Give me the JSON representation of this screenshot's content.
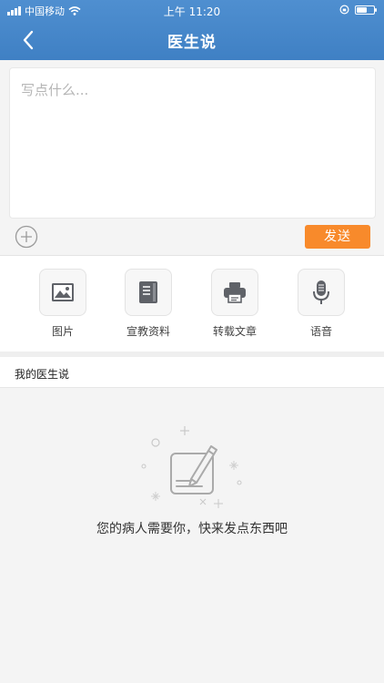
{
  "status_bar": {
    "carrier": "中国移动",
    "time": "上午 11:20"
  },
  "nav": {
    "title": "医生说",
    "back_icon": "chevron-left-icon"
  },
  "composer": {
    "placeholder": "写点什么...",
    "value": "",
    "send_label": "发送",
    "add_icon": "plus-circle-icon",
    "send_color": "#f88a2b"
  },
  "attachments": [
    {
      "label": "图片",
      "icon": "image-icon"
    },
    {
      "label": "宣教资料",
      "icon": "book-icon"
    },
    {
      "label": "转载文章",
      "icon": "printer-icon"
    },
    {
      "label": "语音",
      "icon": "microphone-icon"
    }
  ],
  "feed": {
    "title": "我的医生说",
    "empty_message": "您的病人需要你，快来发点东西吧",
    "empty_icon": "edit-note-illustration"
  },
  "colors": {
    "header": "#4a8ccf",
    "accent": "#f88a2b"
  }
}
